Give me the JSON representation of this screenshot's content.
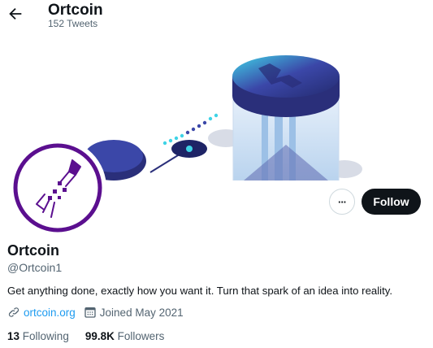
{
  "header": {
    "title": "Ortcoin",
    "tweet_count": "152 Tweets"
  },
  "actions": {
    "more_glyph": "···",
    "follow_label": "Follow"
  },
  "profile": {
    "name": "Ortcoin",
    "handle": "@Ortcoin1",
    "bio": "Get anything done, exactly how you want it. Turn that spark of an idea into reality.",
    "website": "ortcoin.org",
    "joined": "Joined May 2021",
    "following_count": "13",
    "following_label": "Following",
    "followers_count": "99.8K",
    "followers_label": "Followers"
  },
  "icons": {
    "back": "arrow-left-icon",
    "link": "link-icon",
    "calendar": "calendar-icon",
    "more": "more-horizontal-icon"
  },
  "colors": {
    "accent": "#1d9bf0",
    "follow_bg": "#0f1419",
    "logo_purple": "#5b0f8f",
    "coin_navy": "#2a2f7a"
  }
}
